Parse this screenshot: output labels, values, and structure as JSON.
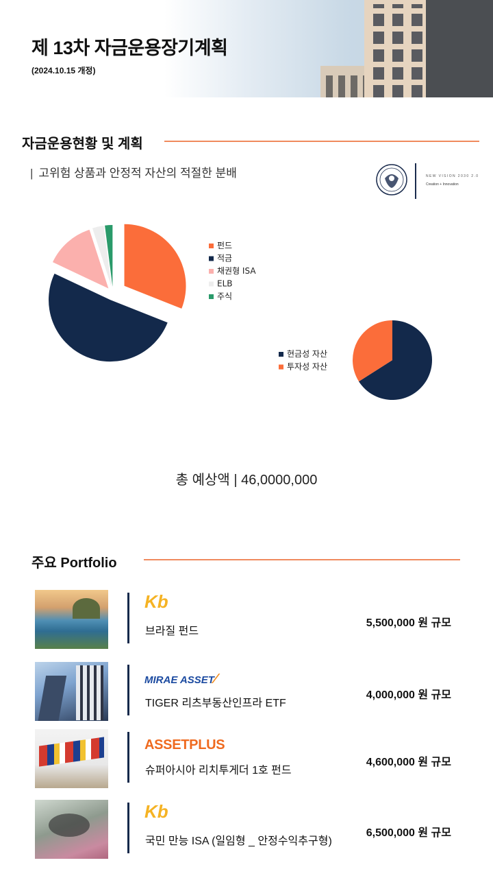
{
  "header": {
    "title": "제 13차 자금운용장기계획",
    "revision": "(2024.10.15 개정)"
  },
  "section1": {
    "title": "자금운용현황 및 계획",
    "subtitle_bar": "|",
    "subtitle": "고위험 상품과 안정적 자산의 적절한 분배"
  },
  "logo": {
    "line1": "NEW VISION 2030 2.0",
    "line2": "Creation + Innovation"
  },
  "chart_data": [
    {
      "type": "pie",
      "categories": [
        "펀드",
        "적금",
        "채권형 ISA",
        "ELB",
        "주식"
      ],
      "values": [
        31,
        51,
        13,
        3,
        2
      ],
      "colors": [
        "#fb6d3a",
        "#13294b",
        "#fbb0ad",
        "#ededed",
        "#2a9a6a"
      ],
      "exploded": true,
      "legend_position": "right"
    },
    {
      "type": "pie",
      "categories": [
        "현금성 자산",
        "투자성 자산"
      ],
      "values": [
        66,
        34
      ],
      "colors": [
        "#13294b",
        "#fb6d3a"
      ],
      "legend_position": "left"
    }
  ],
  "total": {
    "label": "총 예상액 | 46,0000,000"
  },
  "section2": {
    "title": "주요 Portfolio"
  },
  "portfolio": [
    {
      "logo_text": "Kb",
      "name": "브라질 펀드",
      "amount": "5,500,000 원 규모",
      "photo": "coastal-city-photo"
    },
    {
      "logo_text": "MIRAE ASSET",
      "name": "TIGER 리츠부동산인프라 ETF",
      "amount": "4,000,000 원 규모",
      "photo": "skyscraper-photo"
    },
    {
      "logo_text": "ASSETPLUS",
      "name": "슈퍼아시아 리치투게더 1호 펀드",
      "amount": "4,600,000 원 규모",
      "photo": "flags-photo"
    },
    {
      "logo_text": "Kb",
      "name": "국민 만능 ISA (일임형 _ 안정수익추구형)",
      "amount": "6,500,000 원 규모",
      "photo": "banknote-photo"
    }
  ]
}
